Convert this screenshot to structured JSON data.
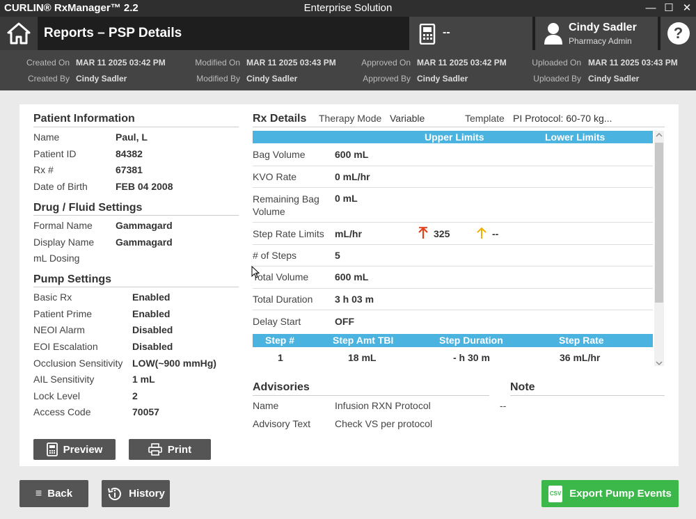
{
  "titlebar": {
    "app_name": "CURLIN® RxManager™  2.2",
    "center": "Enterprise Solution",
    "minimize": "—",
    "maximize": "☐",
    "close": "✕"
  },
  "header": {
    "title": "Reports – PSP Details",
    "pump_value": "--",
    "user_name": "Cindy Sadler",
    "user_role": "Pharmacy Admin",
    "help": "?"
  },
  "meta": {
    "created_on_label": "Created On",
    "created_on": "MAR 11 2025 03:42 PM",
    "created_by_label": "Created By",
    "created_by": "Cindy Sadler",
    "modified_on_label": "Modified On",
    "modified_on": "MAR 11 2025 03:43 PM",
    "modified_by_label": "Modified By",
    "modified_by": "Cindy Sadler",
    "approved_on_label": "Approved On",
    "approved_on": "MAR 11 2025 03:42 PM",
    "approved_by_label": "Approved By",
    "approved_by": "Cindy Sadler",
    "uploaded_on_label": "Uploaded On",
    "uploaded_on": "MAR 11 2025 03:43 PM",
    "uploaded_by_label": "Uploaded By",
    "uploaded_by": "Cindy Sadler"
  },
  "patient": {
    "title": "Patient Information",
    "rows": [
      {
        "label": "Name",
        "value": "Paul, L"
      },
      {
        "label": "Patient ID",
        "value": "84382"
      },
      {
        "label": "Rx #",
        "value": "67381"
      },
      {
        "label": "Date of Birth",
        "value": "FEB 04 2008"
      }
    ]
  },
  "drug": {
    "title": "Drug / Fluid Settings",
    "rows": [
      {
        "label": "Formal Name",
        "value": "Gammagard"
      },
      {
        "label": "Display Name",
        "value": "Gammagard"
      },
      {
        "label": "mL Dosing",
        "value": ""
      }
    ]
  },
  "pump": {
    "title": "Pump Settings",
    "rows": [
      {
        "label": "Basic Rx",
        "value": "Enabled"
      },
      {
        "label": "Patient Prime",
        "value": "Enabled"
      },
      {
        "label": "NEOI Alarm",
        "value": "Disabled"
      },
      {
        "label": "EOI Escalation",
        "value": "Disabled"
      },
      {
        "label": "Occlusion Sensitivity",
        "value": "LOW(~900 mmHg)"
      },
      {
        "label": "AIL Sensitivity",
        "value": "1 mL"
      },
      {
        "label": "Lock Level",
        "value": "2"
      },
      {
        "label": "Access Code",
        "value": "70057"
      }
    ]
  },
  "buttons": {
    "preview": "Preview",
    "print": "Print",
    "back": "Back",
    "history": "History",
    "export": "Export Pump Events",
    "csv": "CSV"
  },
  "rx": {
    "title": "Rx Details",
    "therapy_mode_label": "Therapy Mode",
    "therapy_mode": "Variable",
    "template_label": "Template",
    "template": "PI Protocol: 60-70 kg...",
    "upper_limits": "Upper Limits",
    "lower_limits": "Lower Limits",
    "rows": [
      {
        "label": "Bag Volume",
        "value": "600 mL"
      },
      {
        "label": "KVO Rate",
        "value": "0 mL/hr"
      },
      {
        "label": "Remaining Bag Volume",
        "value": "0 mL"
      },
      {
        "label": "Step Rate Limits",
        "value": "mL/hr",
        "upper": "325",
        "lower": "--"
      },
      {
        "label": "# of Steps",
        "value": "5"
      },
      {
        "label": "Total Volume",
        "value": "600 mL"
      },
      {
        "label": "Total Duration",
        "value": "3 h 03 m"
      },
      {
        "label": "Delay Start",
        "value": "OFF"
      }
    ],
    "step_headers": [
      "Step #",
      "Step Amt TBI",
      "Step Duration",
      "Step Rate"
    ],
    "steps": [
      [
        "1",
        "18 mL",
        "- h 30 m",
        "36 mL/hr"
      ]
    ]
  },
  "advisories": {
    "title": "Advisories",
    "note_title": "Note",
    "name_label": "Name",
    "name": "Infusion RXN Protocol",
    "text_label": "Advisory Text",
    "text": "Check VS per protocol",
    "note": "--"
  },
  "colors": {
    "accent": "#4ab3e0",
    "export": "#3cb84a",
    "upper_arrow": "#e0401a",
    "lower_arrow": "#f0b000"
  }
}
